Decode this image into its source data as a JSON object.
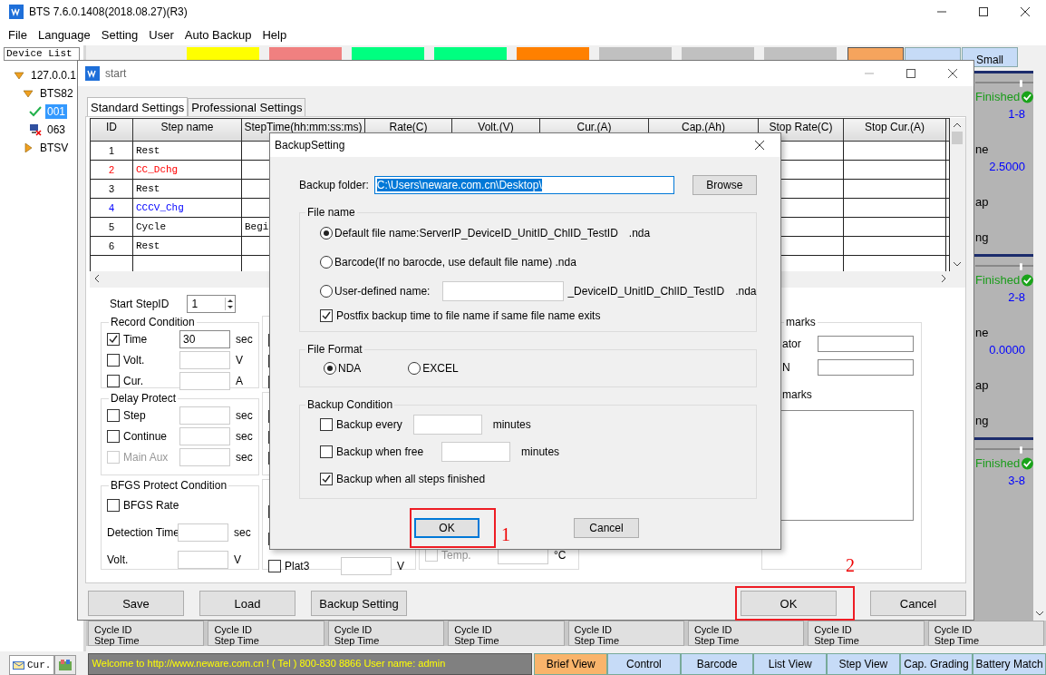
{
  "app_window": {
    "title": "BTS 7.6.0.1408(2018.08.27)(R3)"
  },
  "menu": [
    "File",
    "Language",
    "Setting",
    "User",
    "Auto Backup",
    "Help"
  ],
  "device_list": {
    "header": "Device List",
    "tree": [
      {
        "label": "127.0.0.1",
        "expanded": true,
        "children": [
          {
            "label": "BTS82",
            "expanded": true,
            "children": [
              {
                "label": "001",
                "kind": "online",
                "selected": true
              },
              {
                "label": "063",
                "kind": "offline",
                "selected": false
              }
            ]
          },
          {
            "label": "BTSV",
            "expanded": false
          }
        ]
      }
    ]
  },
  "legend": [
    {
      "color": "#ffff00"
    },
    {
      "color": "#f08080"
    },
    {
      "color": "#00ff80"
    },
    {
      "color": "#00ff80"
    },
    {
      "color": "#ff8000"
    },
    {
      "color": "#c0c0c0"
    },
    {
      "color": "#c0c0c0"
    },
    {
      "color": "#c0c0c0"
    }
  ],
  "size_buttons": [
    {
      "selected": true
    },
    {
      "selected": false
    },
    {
      "label": "Small",
      "selected": false
    }
  ],
  "channel_cards": [
    {
      "status": "Finished",
      "rows": [
        {
          "kind": "value",
          "text": "1-8"
        },
        {
          "kind": "label",
          "text": "ne"
        },
        {
          "kind": "value",
          "text": "2.5000"
        },
        {
          "kind": "label",
          "text": "ap"
        },
        {
          "kind": "label",
          "text": "ng"
        }
      ]
    },
    {
      "status": "Finished",
      "rows": [
        {
          "kind": "value",
          "text": "2-8"
        },
        {
          "kind": "label",
          "text": "ne"
        },
        {
          "kind": "value",
          "text": "0.0000"
        },
        {
          "kind": "label",
          "text": "ap"
        },
        {
          "kind": "label",
          "text": "ng"
        }
      ]
    },
    {
      "status": "Finished",
      "rows": [
        {
          "kind": "value",
          "text": "3-8"
        }
      ]
    }
  ],
  "cycle_cells": [
    {
      "line_1": "Cycle ID",
      "line_2": "Step Time"
    },
    {
      "line_1": "Cycle ID",
      "line_2": "Step Time"
    },
    {
      "line_1": "Cycle ID",
      "line_2": "Step Time"
    },
    {
      "line_1": "Cycle ID",
      "line_2": "Step Time"
    },
    {
      "line_1": "Cycle ID",
      "line_2": "Step Time"
    },
    {
      "line_1": "Cycle ID",
      "line_2": "Step Time"
    },
    {
      "line_1": "Cycle ID",
      "line_2": "Step Time"
    },
    {
      "line_1": "Cycle ID",
      "line_2": "Step Time"
    }
  ],
  "bottom_tabs": [
    {
      "label": "Cur.",
      "selected": true
    },
    {
      "selected": false
    }
  ],
  "status_bar": {
    "text": "Welcome to http://www.neware.com.cn !    ( Tel ) 800-830 8866  User name: admin",
    "tabs": [
      {
        "label": "Brief View",
        "selected": true
      },
      {
        "label": "Control",
        "selected": false
      },
      {
        "label": "Barcode",
        "selected": false
      },
      {
        "label": "List View",
        "selected": false
      },
      {
        "label": "Step View",
        "selected": false
      },
      {
        "label": "Cap. Grading",
        "selected": false
      },
      {
        "label": "Battery Match",
        "selected": false
      }
    ]
  },
  "start_dialog": {
    "title": "start",
    "tabs": [
      {
        "label": "Standard Settings",
        "selected": true
      },
      {
        "label": "Professional Settings",
        "selected": false
      }
    ],
    "columns": [
      "ID",
      "Step name",
      "StepTime(hh:mm:ss:ms)",
      "Rate(C)",
      "Volt.(V)",
      "Cur.(A)",
      "Cap.(Ah)",
      "Stop Rate(C)",
      "Stop Cur.(A)"
    ],
    "rows": [
      {
        "id": "1",
        "name": "Rest",
        "color": "#000000"
      },
      {
        "id": "2",
        "name": "CC_Dchg",
        "color": "#ff0000"
      },
      {
        "id": "3",
        "name": "Rest",
        "color": "#000000"
      },
      {
        "id": "4",
        "name": "CCCV_Chg",
        "color": "#0000ff"
      },
      {
        "id": "5",
        "name": "Cycle",
        "color": "#000000",
        "step_time": "Begi"
      },
      {
        "id": "6",
        "name": "Rest",
        "color": "#000000"
      }
    ],
    "start_step": {
      "label": "Start StepID",
      "value": "1"
    },
    "left_groups": [
      {
        "title": "Record Condition",
        "rows": [
          {
            "kind": "check_field",
            "label": "Time",
            "checked": true,
            "disabled": false,
            "value": "30",
            "unit": "sec"
          },
          {
            "kind": "check_field",
            "label": "Volt.",
            "checked": false,
            "disabled": false,
            "unit": "V"
          },
          {
            "kind": "check_field",
            "label": "Cur.",
            "checked": false,
            "disabled": false,
            "unit": "A"
          }
        ]
      },
      {
        "title": "Delay Protect",
        "rows": [
          {
            "kind": "check_field",
            "label": "Step",
            "checked": false,
            "disabled": false,
            "unit": "sec"
          },
          {
            "kind": "check_field",
            "label": "Continue",
            "checked": false,
            "disabled": false,
            "unit": "sec"
          },
          {
            "kind": "check_field",
            "label": "Main Aux",
            "checked": false,
            "disabled": true,
            "unit": "sec"
          }
        ]
      },
      {
        "title": "BFGS Protect Condition",
        "rows": [
          {
            "kind": "check",
            "label": "BFGS Rate",
            "checked": false,
            "disabled": false
          },
          {
            "kind": "field",
            "label": "Detection Time",
            "unit": "sec"
          },
          {
            "kind": "field",
            "label": "Volt.",
            "unit": "V"
          }
        ]
      }
    ],
    "middle_groups": [
      {
        "rows": [
          {
            "kind": "check"
          },
          {
            "kind": "check"
          },
          {
            "kind": "check"
          }
        ]
      },
      {
        "rows": [
          {
            "kind": "check"
          },
          {
            "kind": "check"
          },
          {
            "kind": "check"
          }
        ]
      },
      {
        "rows": [
          {
            "kind": "check"
          },
          {
            "kind": "check"
          },
          {
            "kind": "check_field",
            "label": "Plat3",
            "checked": false,
            "disabled": false,
            "unit": "V"
          }
        ]
      }
    ],
    "right_groups": [
      {
        "rows": [
          {
            "kind": "check_field",
            "label": "Temp.",
            "checked": false,
            "disabled": true,
            "unit": "°C"
          }
        ]
      }
    ],
    "remarks": {
      "title": "marks",
      "fields": [
        {
          "label": "ator"
        },
        {
          "label": "N"
        }
      ],
      "notes_label": "marks"
    },
    "buttons": [
      "Save",
      "Load",
      "Backup Setting"
    ],
    "ok": "OK",
    "cancel": "Cancel",
    "ok_annotation": "2"
  },
  "backup_dialog": {
    "title": "BackupSetting",
    "folder_label": "Backup folder:",
    "folder_value": "C:\\Users\\neware.com.cn\\Desktop\\",
    "browse": "Browse",
    "file_name": {
      "title": "File name",
      "options": [
        {
          "kind": "default",
          "label": "Default file name:ServerIP_DeviceID_UnitID_ChlID_TestID",
          "ext": ".nda",
          "selected": true
        },
        {
          "kind": "plain",
          "label": "Barcode(If no barocde, use default file name) .nda",
          "selected": false
        },
        {
          "kind": "custom",
          "label": "User-defined name:",
          "suffix": "_DeviceID_UnitID_ChlID_TestID",
          "ext": ".nda",
          "selected": false
        }
      ],
      "postfix": {
        "label": "Postfix backup time to file name if same file name exits",
        "checked": true
      }
    },
    "file_format": {
      "title": "File Format",
      "options": [
        {
          "label": "NDA",
          "selected": true
        },
        {
          "label": "EXCEL",
          "selected": false
        }
      ]
    },
    "condition": {
      "title": "Backup Condition",
      "rows": [
        {
          "kind": "field",
          "label": "Backup every",
          "checked": false,
          "unit": "minutes"
        },
        {
          "kind": "field",
          "label": "Backup when free",
          "checked": false,
          "unit": "minutes"
        },
        {
          "kind": "plain",
          "label": "Backup when all steps finished",
          "checked": true
        }
      ]
    },
    "ok": "OK",
    "cancel": "Cancel",
    "ok_annotation": "1"
  }
}
